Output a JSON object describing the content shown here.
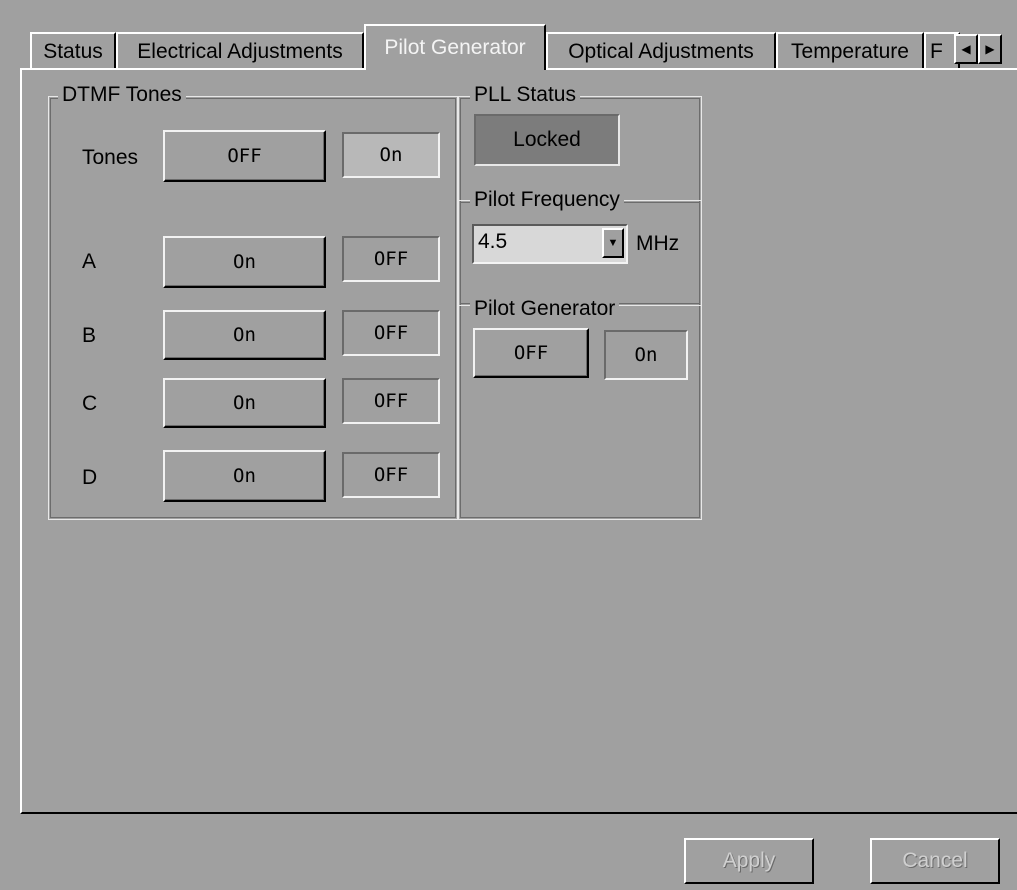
{
  "tabs": {
    "status": "Status",
    "electrical": "Electrical Adjustments",
    "pilot": "Pilot Generator",
    "optical": "Optical Adjustments",
    "temperature": "Temperature",
    "truncated": "F",
    "scroll_left": "◀",
    "scroll_right": "▶"
  },
  "dtmf": {
    "title": "DTMF Tones",
    "tones": {
      "label": "Tones",
      "button": "OFF",
      "indicator": "On"
    },
    "a": {
      "label": "A",
      "button": "On",
      "indicator": "OFF"
    },
    "b": {
      "label": "B",
      "button": "On",
      "indicator": "OFF"
    },
    "c": {
      "label": "C",
      "button": "On",
      "indicator": "OFF"
    },
    "d": {
      "label": "D",
      "button": "On",
      "indicator": "OFF"
    }
  },
  "pll": {
    "title": "PLL Status",
    "value": "Locked"
  },
  "frequency": {
    "title": "Pilot Frequency",
    "value": "4.5",
    "unit": "MHz",
    "arrow": "▼"
  },
  "generator": {
    "title": "Pilot Generator",
    "button": "OFF",
    "indicator": "On"
  },
  "footer": {
    "apply": "Apply",
    "cancel": "Cancel"
  }
}
